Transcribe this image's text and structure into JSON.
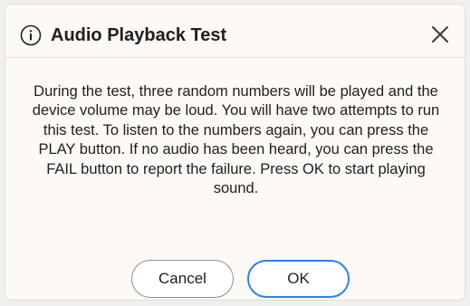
{
  "dialog": {
    "title": "Audio Playback Test",
    "message": "During the test, three random numbers will be played and the device volume may be loud. You will have two attempts to run this test. To listen to the numbers again, you can press the PLAY button. If no audio has been heard, you can press the FAIL button to report the failure. Press OK to start playing sound.",
    "cancel_label": "Cancel",
    "ok_label": "OK",
    "icons": {
      "title_icon": "info-icon",
      "close_icon": "close-icon"
    },
    "colors": {
      "dialog_bg": "#fcf9f6",
      "ok_border": "#2f80ed",
      "cancel_border": "#8f8f8f"
    }
  }
}
